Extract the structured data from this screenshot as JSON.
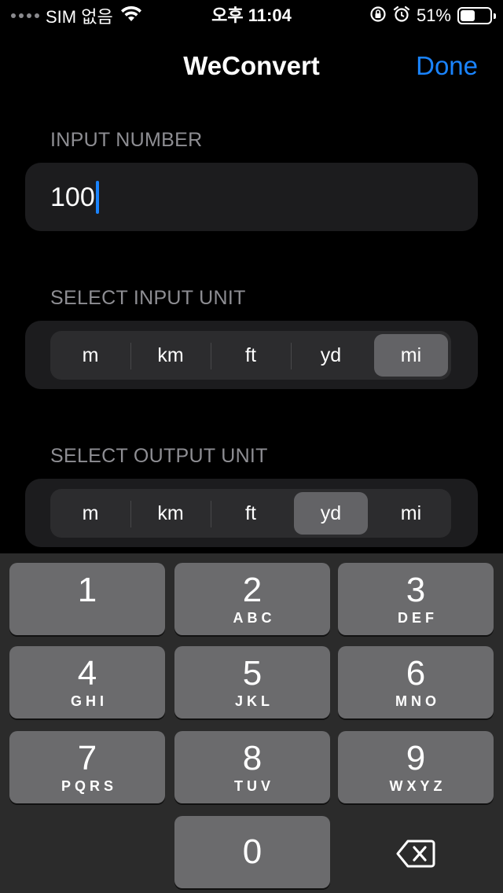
{
  "status_bar": {
    "carrier": "SIM 없음",
    "time": "오후 11:04",
    "battery_percent": "51%",
    "battery_level": 0.51,
    "icons": [
      "signal-dots-icon",
      "wifi-icon",
      "orientation-lock-icon",
      "alarm-icon",
      "battery-icon"
    ]
  },
  "nav": {
    "title": "WeConvert",
    "done_label": "Done",
    "accent_color": "#1a84ff"
  },
  "input_section": {
    "label": "INPUT NUMBER",
    "value": "100"
  },
  "input_unit_section": {
    "label": "SELECT INPUT UNIT",
    "options": [
      "m",
      "km",
      "ft",
      "yd",
      "mi"
    ],
    "selected": "mi"
  },
  "output_unit_section": {
    "label": "SELECT OUTPUT UNIT",
    "options": [
      "m",
      "km",
      "ft",
      "yd",
      "mi"
    ],
    "selected": "yd"
  },
  "keyboard": {
    "keys": [
      {
        "digit": "1",
        "letters": ""
      },
      {
        "digit": "2",
        "letters": "ABC"
      },
      {
        "digit": "3",
        "letters": "DEF"
      },
      {
        "digit": "4",
        "letters": "GHI"
      },
      {
        "digit": "5",
        "letters": "JKL"
      },
      {
        "digit": "6",
        "letters": "MNO"
      },
      {
        "digit": "7",
        "letters": "PQRS"
      },
      {
        "digit": "8",
        "letters": "TUV"
      },
      {
        "digit": "9",
        "letters": "WXYZ"
      },
      {
        "digit": "0",
        "letters": ""
      }
    ],
    "delete_icon": "backspace-icon"
  }
}
